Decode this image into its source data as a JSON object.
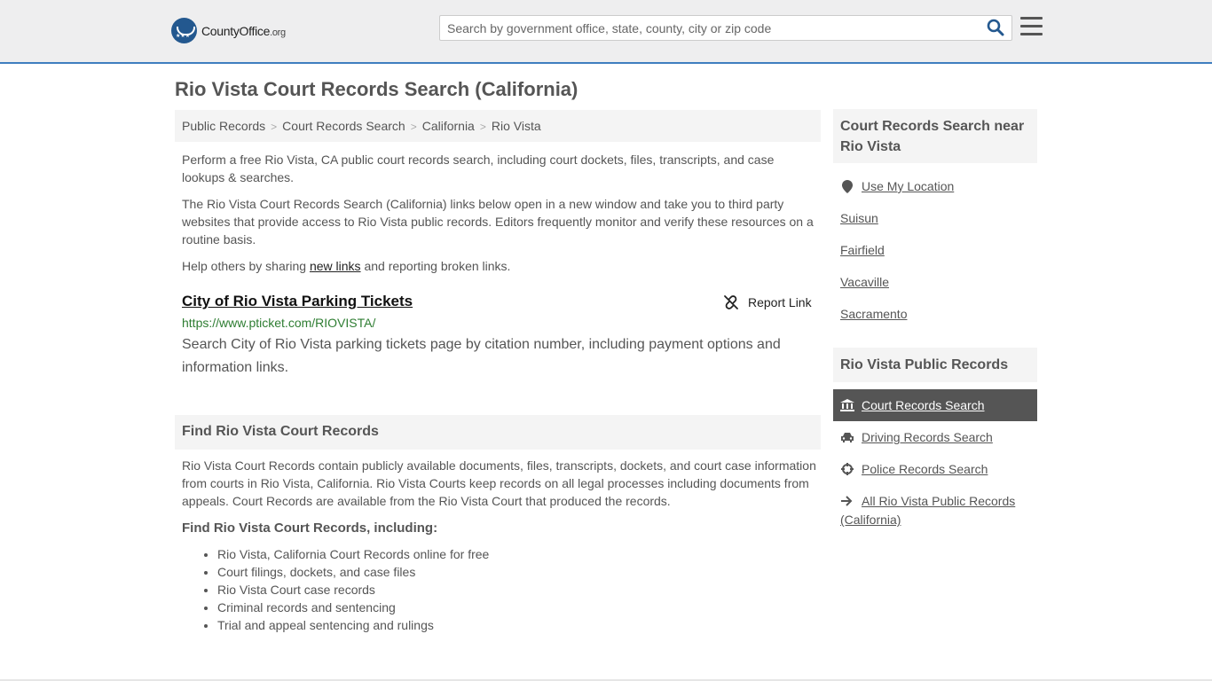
{
  "header": {
    "logo_main": "CountyOffice",
    "logo_org": ".org",
    "search_placeholder": "Search by government office, state, county, city or zip code",
    "accent_color": "#3f7ebf"
  },
  "page": {
    "title": "Rio Vista Court Records Search (California)"
  },
  "breadcrumb": [
    "Public Records",
    "Court Records Search",
    "California",
    "Rio Vista"
  ],
  "intro": {
    "p1": "Perform a free Rio Vista, CA public court records search, including court dockets, files, transcripts, and case lookups & searches.",
    "p2": "The Rio Vista Court Records Search (California) links below open in a new window and take you to third party websites that provide access to Rio Vista public records. Editors frequently monitor and verify these resources on a routine basis.",
    "p3_before": "Help others by sharing ",
    "p3_link": "new links",
    "p3_after": " and reporting broken links."
  },
  "result": {
    "title": "City of Rio Vista Parking Tickets",
    "report_label": "Report Link",
    "url": "https://www.pticket.com/RIOVISTA/",
    "description": "Search City of Rio Vista parking tickets page by citation number, including payment options and information links."
  },
  "find": {
    "heading": "Find Rio Vista Court Records",
    "body": "Rio Vista Court Records contain publicly available documents, files, transcripts, dockets, and court case information from courts in Rio Vista, California. Rio Vista Courts keep records on all legal processes including documents from appeals. Court Records are available from the Rio Vista Court that produced the records.",
    "subheading": "Find Rio Vista Court Records, including:",
    "items": [
      "Rio Vista, California Court Records online for free",
      "Court filings, dockets, and case files",
      "Rio Vista Court case records",
      "Criminal records and sentencing",
      "Trial and appeal sentencing and rulings"
    ]
  },
  "sidebar": {
    "near_heading": "Court Records Search near Rio Vista",
    "use_location": "Use My Location",
    "nearby": [
      "Suisun",
      "Fairfield",
      "Vacaville",
      "Sacramento"
    ],
    "public_heading": "Rio Vista Public Records",
    "active": "Court Records Search",
    "links": [
      "Driving Records Search",
      "Police Records Search"
    ],
    "all_link": "All Rio Vista Public Records (California)"
  }
}
